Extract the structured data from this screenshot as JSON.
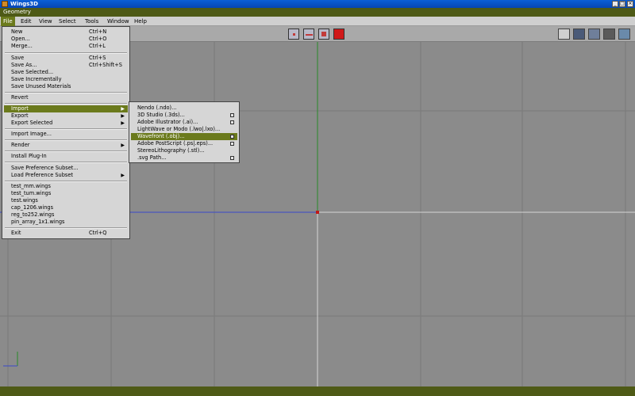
{
  "window": {
    "title": "Wings3D",
    "min_label": "_",
    "max_label": "□",
    "close_label": "×"
  },
  "geometry_title": "Geometry",
  "menubar": [
    "File",
    "Edit",
    "View",
    "Select",
    "Tools",
    "Window",
    "Help"
  ],
  "file_menu": {
    "new": {
      "label": "New",
      "shortcut": "Ctrl+N"
    },
    "open": {
      "label": "Open...",
      "shortcut": "Ctrl+O"
    },
    "merge": {
      "label": "Merge...",
      "shortcut": "Ctrl+L"
    },
    "save": {
      "label": "Save",
      "shortcut": "Ctrl+S"
    },
    "save_as": {
      "label": "Save As...",
      "shortcut": "Ctrl+Shift+S"
    },
    "save_selected": "Save Selected...",
    "save_incrementally": "Save Incrementally",
    "save_unused": "Save Unused Materials",
    "revert": "Revert",
    "import": "Import",
    "export": "Export",
    "export_selected": "Export Selected",
    "import_image": "Import Image...",
    "render": "Render",
    "install_plugin": "Install Plug-In",
    "save_pref_subset": "Save Preference Subset...",
    "load_pref_subset": "Load Preference Subset",
    "recent_files": [
      "test_mm.wings",
      "test_tum.wings",
      "test.wings",
      "cap_1206.wings",
      "reg_to252.wings",
      "pin_array_1x1.wings"
    ],
    "exit": {
      "label": "Exit",
      "shortcut": "Ctrl+Q"
    }
  },
  "import_submenu": [
    {
      "label": "Nendo (.ndo)...",
      "has_options": false
    },
    {
      "label": "3D Studio (.3ds)...",
      "has_options": true
    },
    {
      "label": "Adobe Illustrator (.ai)...",
      "has_options": true
    },
    {
      "label": "LightWave or Modo (.lwo|.lxo)...",
      "has_options": false
    },
    {
      "label": "Wavefront (.obj)...",
      "has_options": true
    },
    {
      "label": "Adobe PostScript (.ps|.eps)...",
      "has_options": true
    },
    {
      "label": "StereoLithography (.stl)...",
      "has_options": false
    },
    {
      "label": ".svg Path...",
      "has_options": true
    }
  ],
  "colors": {
    "accent": "#6b7a1c",
    "status_bar": "#4e5a16",
    "viewport_bg": "#8b8b8b"
  }
}
